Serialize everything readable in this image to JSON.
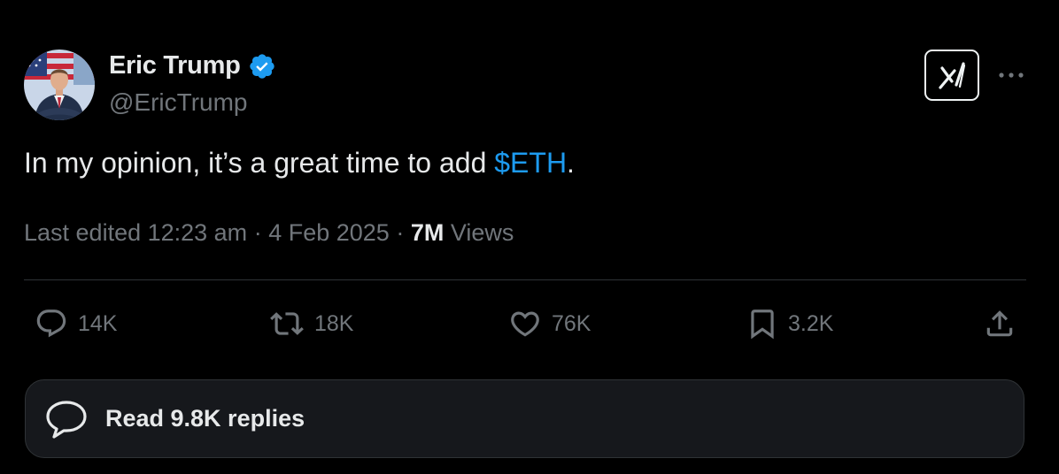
{
  "author": {
    "display_name": "Eric Trump",
    "handle": "@EricTrump",
    "verified": true,
    "avatar_icon": "profile-photo"
  },
  "tweet": {
    "text_before": "In my opinion, it’s a great time to add ",
    "cashtag": "$ETH",
    "text_after": "."
  },
  "meta": {
    "edited_label": "Last edited 12:23 am",
    "separator": "·",
    "date": "4 Feb 2025",
    "views_count": "7M",
    "views_label": "Views"
  },
  "actions": {
    "reply_count": "14K",
    "retweet_count": "18K",
    "like_count": "76K",
    "bookmark_count": "3.2K"
  },
  "replies_button": {
    "label": "Read 9.8K replies"
  },
  "colors": {
    "background": "#000000",
    "text_primary": "#e7e9ea",
    "text_secondary": "#71767b",
    "accent": "#1d9bf0",
    "divider": "#2f3336",
    "card_bg": "#16181c"
  },
  "icons": {
    "grok": "grok-icon",
    "more": "more-horizontal-icon",
    "reply": "reply-icon",
    "retweet": "retweet-icon",
    "like": "heart-icon",
    "bookmark": "bookmark-icon",
    "share": "share-icon",
    "replies_bubble": "chat-bubble-icon"
  }
}
